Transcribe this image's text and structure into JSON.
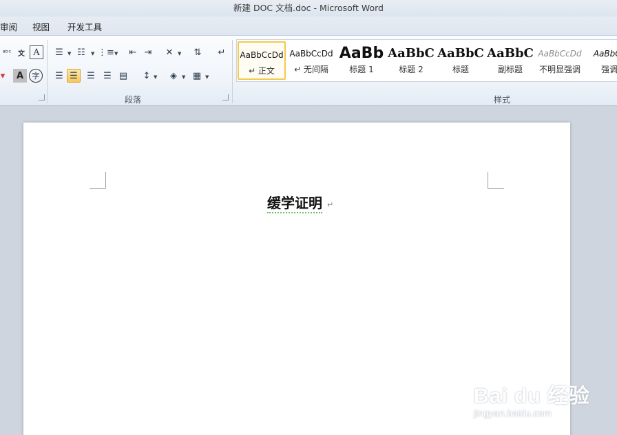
{
  "window": {
    "title": "新建 DOC 文档.doc  -  Microsoft Word"
  },
  "tabs": [
    {
      "label": "审阅"
    },
    {
      "label": "视图"
    },
    {
      "label": "开发工具"
    }
  ],
  "ribbon": {
    "paragraph_group": {
      "label": "段落"
    },
    "styles_group": {
      "label": "样式"
    },
    "font_partial": {
      "text_effect_glyph": "A",
      "char_shade_glyph": "A",
      "enclose_glyph": "字"
    },
    "styles": [
      {
        "sample": "AaBbCcDd",
        "name": "↵ 正文",
        "selected": true
      },
      {
        "sample": "AaBbCcDd",
        "name": "↵ 无间隔"
      },
      {
        "sample": "AaBb",
        "name": "标题 1"
      },
      {
        "sample": "AaBbC",
        "name": "标题 2"
      },
      {
        "sample": "AaBbC",
        "name": "标题"
      },
      {
        "sample": "AaBbC",
        "name": "副标题"
      },
      {
        "sample": "AaBbCcDd",
        "name": "不明显强调"
      },
      {
        "sample": "AaBbCc",
        "name": "强调"
      }
    ]
  },
  "document": {
    "title_text": "缓学证明",
    "paragraph_mark": "↵"
  },
  "watermark": {
    "logo": "Bai du 经验",
    "url": "jingyan.baidu.com"
  },
  "colors": {
    "accent_selected": "#f3c94f",
    "squiggle": "#6abf63"
  }
}
